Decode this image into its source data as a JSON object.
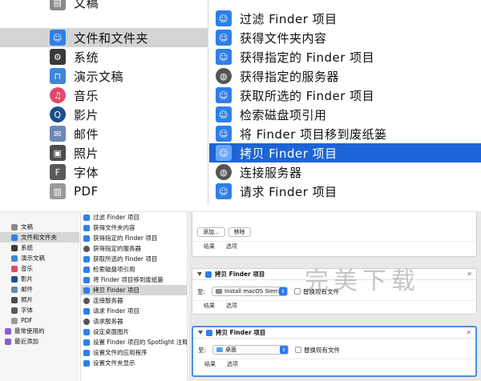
{
  "top": {
    "categories": [
      {
        "label": "文稿",
        "icon": "document-icon",
        "color": "#7d7d7d"
      },
      {
        "label": "文件和文件夹",
        "icon": "finder-icon",
        "color": "#2f7fe8",
        "selected": true
      },
      {
        "label": "系统",
        "icon": "system-icon",
        "color": "#3a3a3a"
      },
      {
        "label": "演示文稿",
        "icon": "keynote-icon",
        "color": "#3e86d8"
      },
      {
        "label": "音乐",
        "icon": "music-icon",
        "color": "#e04a6a"
      },
      {
        "label": "影片",
        "icon": "quicktime-icon",
        "color": "#1d4d8c"
      },
      {
        "label": "邮件",
        "icon": "mail-icon",
        "color": "#6b88b8"
      },
      {
        "label": "照片",
        "icon": "photos-icon",
        "color": "#4d4d4d"
      },
      {
        "label": "字体",
        "icon": "font-icon",
        "color": "#5a5a5a"
      },
      {
        "label": "PDF",
        "icon": "pdf-icon",
        "color": "#8a8a8a"
      }
    ],
    "actions": [
      {
        "label": "过滤 Finder 项目",
        "icon": "finder-icon"
      },
      {
        "label": "获得文件夹内容",
        "icon": "finder-icon"
      },
      {
        "label": "获得指定的 Finder 项目",
        "icon": "finder-icon"
      },
      {
        "label": "获得指定的服务器",
        "icon": "network-globe-icon"
      },
      {
        "label": "获取所选的 Finder 项目",
        "icon": "finder-icon"
      },
      {
        "label": "检索磁盘项引用",
        "icon": "finder-icon"
      },
      {
        "label": "将 Finder 项目移到废纸篓",
        "icon": "finder-icon"
      },
      {
        "label": "拷贝 Finder 项目",
        "icon": "finder-icon",
        "selected": true
      },
      {
        "label": "连接服务器",
        "icon": "network-globe-icon"
      },
      {
        "label": "请求 Finder 项目",
        "icon": "finder-icon"
      }
    ]
  },
  "bottom": {
    "categories": [
      {
        "label": "文稿"
      },
      {
        "label": "文件和文件夹",
        "selected": true
      },
      {
        "label": "系统"
      },
      {
        "label": "演示文稿"
      },
      {
        "label": "音乐"
      },
      {
        "label": "影片"
      },
      {
        "label": "邮件"
      },
      {
        "label": "照片"
      },
      {
        "label": "字体"
      },
      {
        "label": "PDF"
      },
      {
        "label": "最常使用的"
      },
      {
        "label": "最近添加"
      }
    ],
    "actions": [
      {
        "label": "过滤 Finder 项目"
      },
      {
        "label": "获得文件夹内容"
      },
      {
        "label": "获得指定的 Finder 项目"
      },
      {
        "label": "获得指定的服务器"
      },
      {
        "label": "获取所选的 Finder 项目"
      },
      {
        "label": "检索磁盘项引用"
      },
      {
        "label": "将 Finder 项目移到废纸篓"
      },
      {
        "label": "拷贝 Finder 项目",
        "selected": true
      },
      {
        "label": "连接服务器"
      },
      {
        "label": "请求 Finder 项目"
      },
      {
        "label": "请求服务器"
      },
      {
        "label": "设定桌面图片"
      },
      {
        "label": "设置 Finder 项目的 Spotlight 注释"
      },
      {
        "label": "设置文件的应用程序"
      },
      {
        "label": "设置文件夹显示"
      }
    ],
    "top_card": {
      "add_label": "添加...",
      "remove_label": "移除",
      "results_label": "结果",
      "options_label": "选项"
    },
    "card1": {
      "title": "拷贝 Finder 项目",
      "to_label": "至:",
      "destination": "Install macOS Sierra",
      "replace_label": "替换现有文件",
      "results_label": "结果",
      "options_label": "选项"
    },
    "card2": {
      "title": "拷贝 Finder 项目",
      "to_label": "至:",
      "destination": "桌面",
      "replace_label": "替换现有文件",
      "results_label": "结果",
      "options_label": "选项"
    }
  },
  "watermark": "完美下载",
  "colors": {
    "selection_blue": "#1d64d6",
    "selection_gray": "#d4d4d4",
    "finder_blue": "#2f7fe8"
  }
}
